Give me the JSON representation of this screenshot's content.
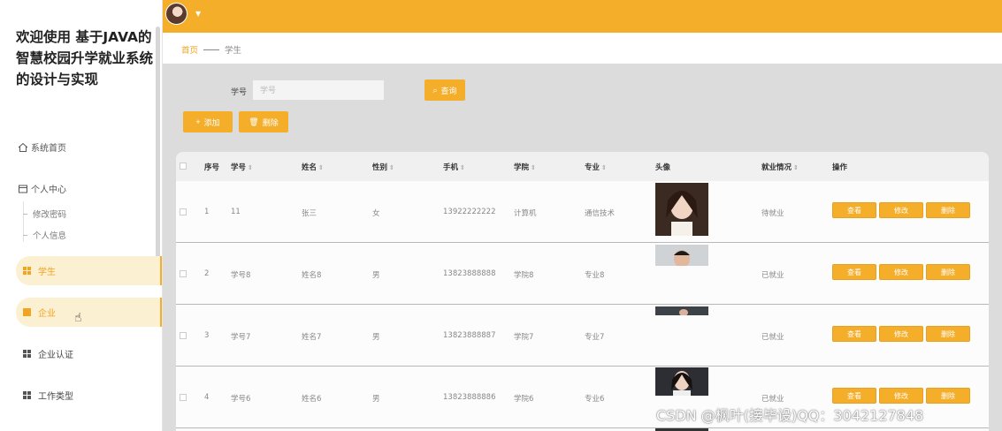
{
  "app": {
    "title": "欢迎使用 基于JAVA的智慧校园升学就业系统的设计与实现"
  },
  "nav": {
    "home": "系统首页",
    "personal_center": "个人中心",
    "change_password": "修改密码",
    "personal_info": "个人信息",
    "menu": [
      "学生",
      "企业",
      "企业认证",
      "工作类型"
    ]
  },
  "breadcrumb": {
    "home": "首页",
    "current": "学生"
  },
  "search": {
    "label": "学号",
    "placeholder": "学号",
    "query_button": "查询"
  },
  "toolbar": {
    "add_label": "添加",
    "delete_label": "删除"
  },
  "table": {
    "headers": {
      "index": "序号",
      "student_no": "学号",
      "name": "姓名",
      "gender": "性别",
      "phone": "手机",
      "college": "学院",
      "major": "专业",
      "avatar": "头像",
      "employment": "就业情况",
      "ops": "操作"
    },
    "rows": [
      {
        "index": "1",
        "student_no": "11",
        "name": "张三",
        "gender": "女",
        "phone": "13922222222",
        "college": "计算机",
        "major": "通信技术",
        "employment": "待就业"
      },
      {
        "index": "2",
        "student_no": "学号8",
        "name": "姓名8",
        "gender": "男",
        "phone": "13823888888",
        "college": "学院8",
        "major": "专业8",
        "employment": "已就业"
      },
      {
        "index": "3",
        "student_no": "学号7",
        "name": "姓名7",
        "gender": "男",
        "phone": "13823888887",
        "college": "学院7",
        "major": "专业7",
        "employment": "已就业"
      },
      {
        "index": "4",
        "student_no": "学号6",
        "name": "姓名6",
        "gender": "男",
        "phone": "13823888886",
        "college": "学院6",
        "major": "专业6",
        "employment": "已就业"
      }
    ],
    "actions": {
      "view": "查看",
      "edit": "修改",
      "delete": "删除"
    }
  },
  "watermark": "CSDN @枫叶(接毕设)QQ：3042127848",
  "colors": {
    "accent": "#f4ae2a",
    "active_bg": "#fbf0d2"
  }
}
